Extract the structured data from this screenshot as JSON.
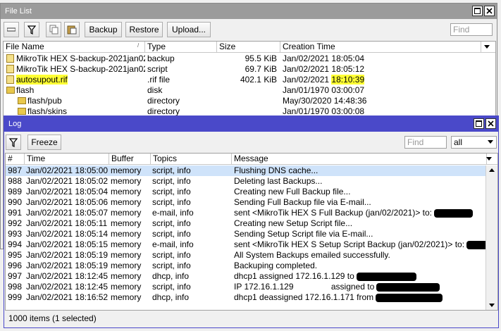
{
  "filelist": {
    "title": "File List",
    "buttons": {
      "backup": "Backup",
      "restore": "Restore",
      "upload": "Upload..."
    },
    "search_placeholder": "Find",
    "columns": [
      "File Name",
      "Type",
      "Size",
      "Creation Time"
    ],
    "rows": [
      {
        "name": "MikroTik HEX S-backup-2021jan02...",
        "type": "backup",
        "size": "95.5 KiB",
        "time": "Jan/02/2021 18:05:04",
        "icon": "file-icon",
        "indent": 0
      },
      {
        "name": "MikroTik HEX S-backup-2021jan02...",
        "type": "script",
        "size": "69.7 KiB",
        "time": "Jan/02/2021 18:05:12",
        "icon": "file-icon",
        "indent": 0
      },
      {
        "name": "autosupout.rif",
        "type": ".rif file",
        "size": "402.1 KiB",
        "time": "Jan/02/2021 18:10:39",
        "icon": "file-icon",
        "indent": 0,
        "highlight": true
      },
      {
        "name": "flash",
        "type": "disk",
        "size": "",
        "time": "Jan/01/1970 03:00:07",
        "icon": "folder-icon",
        "indent": 0
      },
      {
        "name": "flash/pub",
        "type": "directory",
        "size": "",
        "time": "May/30/2020 14:48:36",
        "icon": "folder-icon",
        "indent": 1
      },
      {
        "name": "flash/skins",
        "type": "directory",
        "size": "",
        "time": "Jan/01/1970 03:00:08",
        "icon": "folder-icon",
        "indent": 1
      }
    ]
  },
  "log": {
    "title": "Log",
    "freeze": "Freeze",
    "search_placeholder": "Find",
    "filter_value": "all",
    "columns": [
      "#",
      "Time",
      "Buffer",
      "Topics",
      "Message"
    ],
    "rows": [
      {
        "n": "987",
        "time": "Jan/02/2021 18:05:00",
        "buffer": "memory",
        "topics": "script, info",
        "msg": "Flushing DNS cache...",
        "selected": true
      },
      {
        "n": "988",
        "time": "Jan/02/2021 18:05:02",
        "buffer": "memory",
        "topics": "script, info",
        "msg": "Deleting last Backups..."
      },
      {
        "n": "989",
        "time": "Jan/02/2021 18:05:04",
        "buffer": "memory",
        "topics": "script, info",
        "msg": "Creating new Full Backup file..."
      },
      {
        "n": "990",
        "time": "Jan/02/2021 18:05:06",
        "buffer": "memory",
        "topics": "script, info",
        "msg": "Sending Full Backup file via E-mail..."
      },
      {
        "n": "991",
        "time": "Jan/02/2021 18:05:07",
        "buffer": "memory",
        "topics": "e-mail, info",
        "msg": "sent <MikroTik HEX S Full Backup (jan/02/2021)> to:",
        "redact": 55
      },
      {
        "n": "992",
        "time": "Jan/02/2021 18:05:11",
        "buffer": "memory",
        "topics": "script, info",
        "msg": "Creating new Setup Script file..."
      },
      {
        "n": "993",
        "time": "Jan/02/2021 18:05:14",
        "buffer": "memory",
        "topics": "script, info",
        "msg": "Sending Setup Script file via E-mail..."
      },
      {
        "n": "994",
        "time": "Jan/02/2021 18:05:15",
        "buffer": "memory",
        "topics": "e-mail, info",
        "msg": "sent <MikroTik HEX S Setup Script Backup (jan/02/2021)> to:",
        "redact": 55
      },
      {
        "n": "995",
        "time": "Jan/02/2021 18:05:19",
        "buffer": "memory",
        "topics": "script, info",
        "msg": "All System Backups emailed successfully."
      },
      {
        "n": "996",
        "time": "Jan/02/2021 18:05:19",
        "buffer": "memory",
        "topics": "script, info",
        "msg": "Backuping completed."
      },
      {
        "n": "997",
        "time": "Jan/02/2021 18:12:45",
        "buffer": "memory",
        "topics": "dhcp, info",
        "msg": "dhcp1 assigned 172.16.1.129 to",
        "redact": 85
      },
      {
        "n": "998",
        "time": "Jan/02/2021 18:12:45",
        "buffer": "memory",
        "topics": "script, info",
        "msg": "IP 172.16.1.129                assigned to",
        "redact": 90
      },
      {
        "n": "999",
        "time": "Jan/02/2021 18:16:52",
        "buffer": "memory",
        "topics": "dhcp, info",
        "msg": "dhcp1 deassigned 172.16.1.171 from",
        "redact": 95
      }
    ],
    "status": "1000 items (1 selected)"
  },
  "colors": {
    "log_title_bg": "#4a49c9",
    "log_title_text": "#ffffff",
    "selected_row": "#cfe3fa",
    "highlight": "#ffff33"
  }
}
